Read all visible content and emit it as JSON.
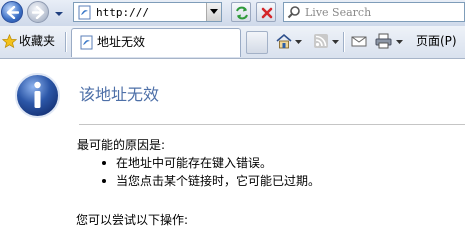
{
  "browser": {
    "address": {
      "value": "http:///"
    },
    "search": {
      "placeholder": "Live Search"
    },
    "favorites_label": "收藏夹",
    "tab": {
      "label": "地址无效"
    },
    "page_menu_label": "页面(P)"
  },
  "page": {
    "title": "该地址无效",
    "reasons_heading": "最可能的原因是:",
    "reasons": [
      "在地址中可能存在键入错误。",
      "当您点击某个链接时，它可能已过期。"
    ],
    "try_heading": "您可以尝试以下操作:"
  },
  "colors": {
    "title": "#4e70a8",
    "info_icon": "#2c57a8"
  },
  "icons": {
    "back": "back-arrow-icon",
    "forward": "forward-arrow-icon",
    "refresh": "refresh-icon",
    "stop": "stop-icon",
    "search": "search-icon",
    "favorites": "star-icon",
    "home": "home-icon",
    "feeds": "rss-icon",
    "print": "printer-icon",
    "info": "info-icon"
  }
}
